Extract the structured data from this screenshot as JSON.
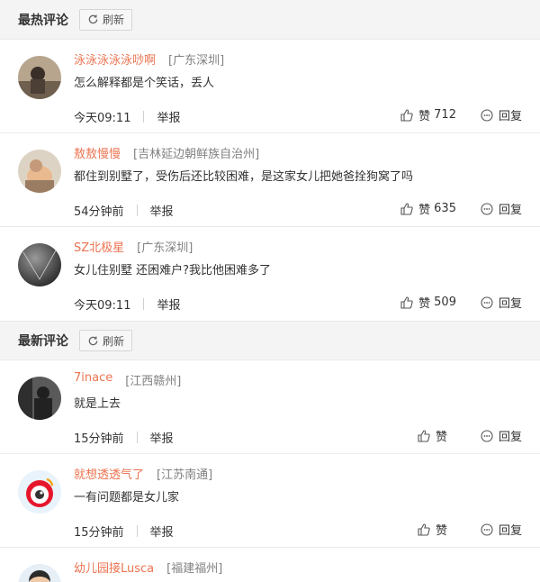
{
  "hot": {
    "title": "最热评论",
    "refresh_label": "刷新",
    "comments": [
      {
        "user": "泳泳泳泳泳唦啊",
        "location": "[广东深圳]",
        "text": "怎么解释都是个笑话，丢人",
        "time": "今天09:11",
        "report": "举报",
        "like_label": "赞",
        "like_count": "712",
        "reply_label": "回复"
      },
      {
        "user": "敖敖慢慢",
        "location": "[吉林延边朝鲜族自治州]",
        "text": "都住到别墅了，受伤后还比较困难，是这家女儿把她爸拴狗窝了吗",
        "time": "54分钟前",
        "report": "举报",
        "like_label": "赞",
        "like_count": "635",
        "reply_label": "回复"
      },
      {
        "user": "SZ北极星",
        "location": "[广东深圳]",
        "text": "女儿住别墅 还困难户?我比他困难多了",
        "time": "今天09:11",
        "report": "举报",
        "like_label": "赞",
        "like_count": "509",
        "reply_label": "回复"
      }
    ]
  },
  "latest": {
    "title": "最新评论",
    "refresh_label": "刷新",
    "comments": [
      {
        "user": "7inace",
        "location": "[江西赣州]",
        "text": "就是上去",
        "time": "15分钟前",
        "report": "举报",
        "like_label": "赞",
        "like_count": "",
        "reply_label": "回复"
      },
      {
        "user": "就想透透气了",
        "location": "[江苏南通]",
        "text": "一有问题都是女儿家",
        "time": "15分钟前",
        "report": "举报",
        "like_label": "赞",
        "like_count": "",
        "reply_label": "回复"
      },
      {
        "user": "幼儿园接Lusca",
        "location": "[福建福州]",
        "text": "",
        "time": "",
        "report": "",
        "like_label": "",
        "like_count": "",
        "reply_label": ""
      }
    ]
  },
  "colors": {
    "username": "#eb7350",
    "location": "#808080",
    "header_bg": "#f4f4f4"
  },
  "icons": {
    "refresh": "refresh-icon",
    "like": "thumbs-up-icon",
    "reply": "speech-bubble-icon"
  }
}
